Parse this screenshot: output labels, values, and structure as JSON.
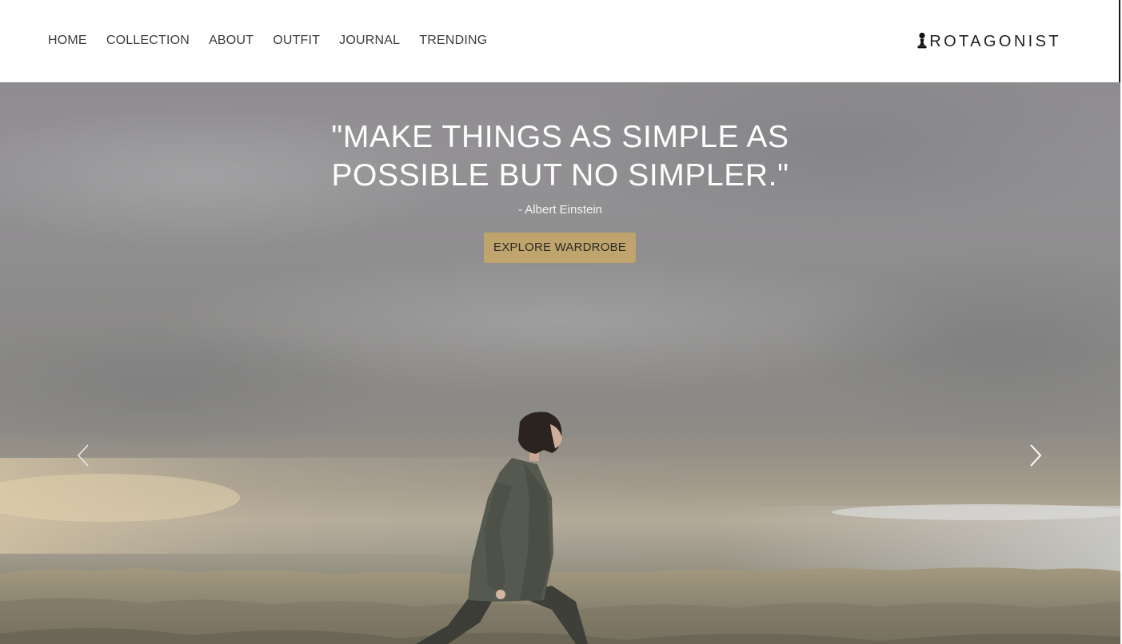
{
  "nav": {
    "links": [
      {
        "label": "HOME"
      },
      {
        "label": "COLLECTION"
      },
      {
        "label": "ABOUT"
      },
      {
        "label": "OUTFIT"
      },
      {
        "label": "JOURNAL"
      },
      {
        "label": "TRENDING"
      }
    ],
    "brand": {
      "icon": "chess-pawn-icon",
      "text": "ROTAGONIST"
    }
  },
  "hero": {
    "quote_line1": "\"MAKE THINGS AS SIMPLE AS",
    "quote_line2": "POSSIBLE BUT NO SIMPLER.\"",
    "author": "- Albert Einstein",
    "cta_label": "EXPLORE WARDROBE",
    "prev_icon": "chevron-left-icon",
    "next_icon": "chevron-right-icon"
  },
  "colors": {
    "accent": "#c0a46e",
    "nav_text": "#3d3d3d",
    "hero_text": "#ffffff"
  }
}
